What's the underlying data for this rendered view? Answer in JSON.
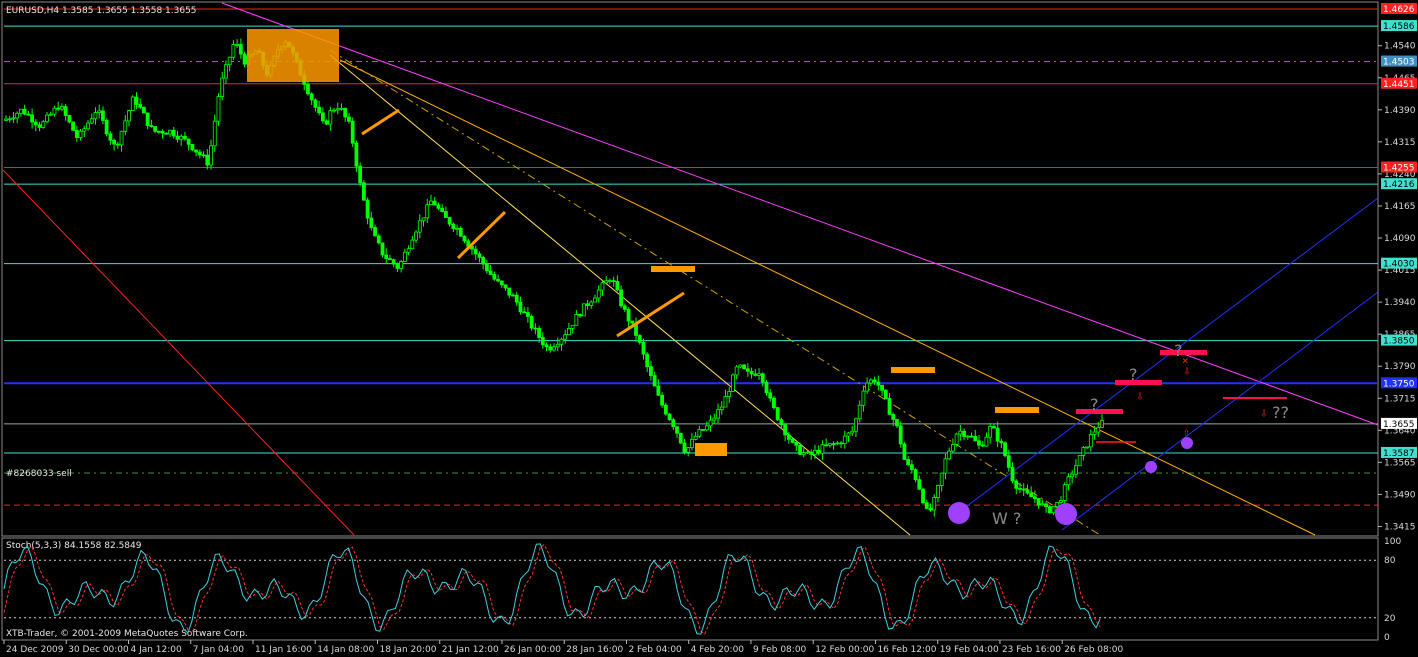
{
  "header": {
    "title": "EURUSD,H4  1.3585 1.3655 1.3558 1.3655",
    "order_label": "#8268033 sell",
    "indicator_label": "Stoch(5,3,3) 84.1558 82.5849",
    "copyright": "XTB-Trader, © 2001-2009 MetaQuotes Software Corp."
  },
  "annotations": {
    "w_label": "W ?",
    "q1": "?",
    "q2": "?",
    "q3": "?",
    "q4": "??"
  },
  "colors": {
    "background": "#000000",
    "bull": "#00ff00",
    "bear": "#00ff00",
    "cyan_level": "#40e0d0",
    "red_level": "#ff2020",
    "blue_level": "#2030ff",
    "magenta": "#ff40ff",
    "orange": "#ff9900",
    "purple": "#a040ff",
    "crimson": "#ff1050"
  },
  "chart_data": {
    "type": "candlestick",
    "symbol": "EURUSD",
    "timeframe": "H4",
    "ylim": [
      1.3395,
      1.464
    ],
    "price_ticks": [
      "1.4540",
      "1.4465",
      "1.4390",
      "1.4315",
      "1.4240",
      "1.4165",
      "1.4090",
      "1.4015",
      "1.3940",
      "1.3865",
      "1.3790",
      "1.3715",
      "1.3640",
      "1.3565",
      "1.3490",
      "1.3415"
    ],
    "level_labels": [
      {
        "value": 1.4626,
        "text": "1.4626",
        "color": "#ff2020"
      },
      {
        "value": 1.4586,
        "text": "1.4586",
        "color": "#40e0d0"
      },
      {
        "value": 1.4503,
        "text": "1.4503",
        "color": "#4090c0"
      },
      {
        "value": 1.4451,
        "text": "1.4451",
        "color": "#ff2020"
      },
      {
        "value": 1.4255,
        "text": "1.4255",
        "color": "#ff2020"
      },
      {
        "value": 1.4216,
        "text": "1.4216",
        "color": "#40e0d0"
      },
      {
        "value": 1.403,
        "text": "1.4030",
        "color": "#40e0d0"
      },
      {
        "value": 1.385,
        "text": "1.3850",
        "color": "#40e0d0"
      },
      {
        "value": 1.375,
        "text": "1.3750",
        "color": "#2030ff"
      },
      {
        "value": 1.3655,
        "text": "1.3655",
        "color": "#ffffff"
      },
      {
        "value": 1.3587,
        "text": "1.3587",
        "color": "#40e0d0"
      }
    ],
    "time_labels": [
      "24 Dec 2009",
      "30 Dec 00:00",
      "4 Jan 12:00",
      "7 Jan 04:00",
      "11 Jan 16:00",
      "14 Jan 08:00",
      "18 Jan 20:00",
      "21 Jan 12:00",
      "26 Jan 00:00",
      "28 Jan 16:00",
      "2 Feb 04:00",
      "4 Feb 20:00",
      "9 Feb 08:00",
      "12 Feb 00:00",
      "16 Feb 12:00",
      "19 Feb 04:00",
      "23 Feb 16:00",
      "26 Feb 08:00"
    ],
    "price_path": [
      [
        0,
        1.4365
      ],
      [
        5,
        1.439
      ],
      [
        10,
        1.4352
      ],
      [
        15,
        1.4402
      ],
      [
        20,
        1.4322
      ],
      [
        25,
        1.4392
      ],
      [
        30,
        1.43
      ],
      [
        35,
        1.442
      ],
      [
        40,
        1.434
      ],
      [
        45,
        1.434
      ],
      [
        50,
        1.431
      ],
      [
        55,
        1.4265
      ],
      [
        58,
        1.444
      ],
      [
        62,
        1.455
      ],
      [
        65,
        1.45
      ],
      [
        68,
        1.453
      ],
      [
        71,
        1.447
      ],
      [
        74,
        1.454
      ],
      [
        76,
        1.4555
      ],
      [
        80,
        1.447
      ],
      [
        83,
        1.441
      ],
      [
        86,
        1.435
      ],
      [
        88,
        1.439
      ],
      [
        90,
        1.44
      ],
      [
        93,
        1.435
      ],
      [
        96,
        1.42
      ],
      [
        99,
        1.41
      ],
      [
        102,
        1.405
      ],
      [
        106,
        1.402
      ],
      [
        110,
        1.41
      ],
      [
        115,
        1.418
      ],
      [
        118,
        1.414
      ],
      [
        122,
        1.411
      ],
      [
        127,
        1.405
      ],
      [
        132,
        1.399
      ],
      [
        137,
        1.395
      ],
      [
        142,
        1.388
      ],
      [
        146,
        1.383
      ],
      [
        150,
        1.386
      ],
      [
        155,
        1.392
      ],
      [
        160,
        1.397
      ],
      [
        163,
        1.4
      ],
      [
        166,
        1.393
      ],
      [
        170,
        1.386
      ],
      [
        173,
        1.378
      ],
      [
        176,
        1.371
      ],
      [
        180,
        1.365
      ],
      [
        183,
        1.359
      ],
      [
        186,
        1.363
      ],
      [
        189,
        1.365
      ],
      [
        193,
        1.37
      ],
      [
        197,
        1.379
      ],
      [
        200,
        1.377
      ],
      [
        203,
        1.378
      ],
      [
        206,
        1.37
      ],
      [
        209,
        1.365
      ],
      [
        212,
        1.36
      ],
      [
        216,
        1.358
      ],
      [
        220,
        1.36
      ],
      [
        224,
        1.361
      ],
      [
        228,
        1.364
      ],
      [
        231,
        1.375
      ],
      [
        234,
        1.376
      ],
      [
        237,
        1.37
      ],
      [
        240,
        1.364
      ],
      [
        242,
        1.356
      ],
      [
        244,
        1.3545
      ],
      [
        246,
        1.35
      ],
      [
        248,
        1.344
      ],
      [
        250,
        1.348
      ],
      [
        253,
        1.358
      ],
      [
        256,
        1.364
      ],
      [
        259,
        1.363
      ],
      [
        262,
        1.36
      ],
      [
        265,
        1.365
      ],
      [
        268,
        1.36
      ],
      [
        271,
        1.352
      ],
      [
        274,
        1.349
      ],
      [
        277,
        1.348
      ],
      [
        280,
        1.345
      ],
      [
        283,
        1.347
      ],
      [
        286,
        1.353
      ],
      [
        289,
        1.358
      ],
      [
        292,
        1.363
      ],
      [
        294,
        1.3655
      ]
    ],
    "stochastic": {
      "name": "Stoch(5,3,3)",
      "main": 84.1558,
      "signal": 82.5849,
      "ylim": [
        0,
        100
      ],
      "levels": [
        80,
        20
      ],
      "tick_labels": [
        "100",
        "80",
        "20",
        "0"
      ]
    }
  }
}
